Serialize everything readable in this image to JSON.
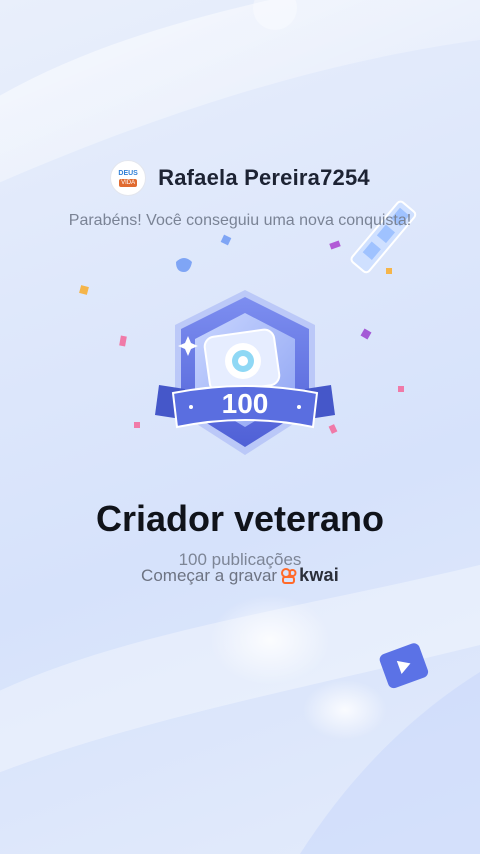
{
  "header": {
    "username": "Rafaela Pereira7254",
    "avatar_text_top": "DEUS",
    "avatar_text_bottom": "VIDA",
    "congrats": "Parabéns! Você conseguiu uma nova conquista!"
  },
  "badge": {
    "number": "100",
    "icon": "camera-icon"
  },
  "achievement": {
    "title": "Criador veterano",
    "subtitle": "100 publicações"
  },
  "cta": {
    "label": "Começar a gravar",
    "brand": "kwai"
  },
  "colors": {
    "accent": "#5b6fe0",
    "brand_orange": "#ff6a2a",
    "text_dark": "#10131a"
  }
}
